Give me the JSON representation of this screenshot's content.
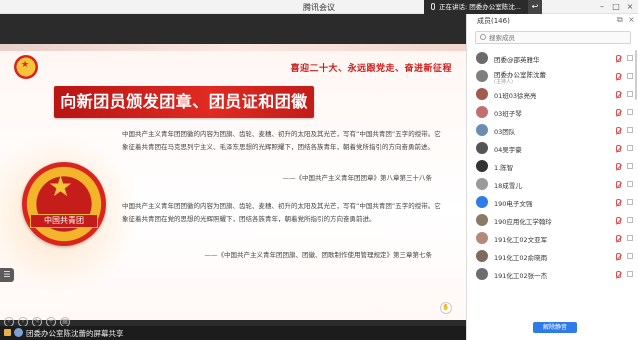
{
  "app": {
    "title": "腾讯会议"
  },
  "speaking": {
    "text": "正在讲话: 团委办公室陈沈..."
  },
  "slide": {
    "slogan": "喜迎二十大、永远跟党走、奋进新征程",
    "title": "向新团员颁发团章、团员证和团徽",
    "emblem_text": "中国共青团",
    "paragraph1": "中国共产主义青年团团徽的内容为团旗、齿轮、麦穗、初升的太阳及其光芒，写有“中国共青团”五字的绶带。它象征着共青团在马克思列宁主义、毛泽东思想的光辉照耀下，团结各族青年，朝着党所指引的方向奋勇前进。",
    "citation1": "——《中国共产主义青年团团章》第八章第三十八条",
    "paragraph2": "中国共产主义青年团团徽的内容为团旗、齿轮、麦穗、初升的太阳及其光芒，写有“中国共青团”五字的绶带。它象征着共青团在党的思想的光辉照耀下，团结各族青年，朝着党所指引的方向奋勇前进。",
    "citation2": "——《中国共产主义青年团团旗、团徽、团歌制作使用管理规定》第三章第七条"
  },
  "status": {
    "text": "团委办公室陈沈蕾的屏幕共享"
  },
  "panel": {
    "title": "成员(146)",
    "search_placeholder": "搜索成员",
    "members": [
      {
        "name": "团委@邵英雅华",
        "sub": ""
      },
      {
        "name": "团委办公室陈沈蕾",
        "sub": "(主持人)"
      },
      {
        "name": "01班03徐亮亮",
        "sub": ""
      },
      {
        "name": "03班子琴",
        "sub": ""
      },
      {
        "name": "03团队",
        "sub": ""
      },
      {
        "name": "04吴宇豪",
        "sub": ""
      },
      {
        "name": "1.陈智",
        "sub": ""
      },
      {
        "name": "18成雪儿",
        "sub": ""
      },
      {
        "name": "190电子文强",
        "sub": ""
      },
      {
        "name": "190应用化工学翰玲",
        "sub": ""
      },
      {
        "name": "191化工02文亚军",
        "sub": ""
      },
      {
        "name": "191化工02俞晓雨",
        "sub": ""
      },
      {
        "name": "191化工02张一杰",
        "sub": ""
      }
    ],
    "mute_all_label": "解除静音"
  }
}
